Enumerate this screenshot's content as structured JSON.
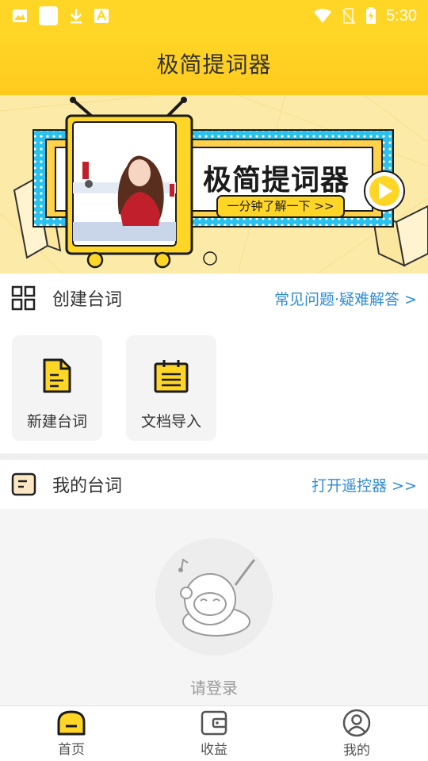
{
  "status_bar": {
    "time": "5:30",
    "left_icons": [
      "image-icon",
      "square-notification-icon",
      "download-icon",
      "app-a-icon"
    ],
    "right_icons": [
      "wifi-icon",
      "no-sim-icon",
      "battery-charging-icon"
    ]
  },
  "header": {
    "title": "极简提词器"
  },
  "banner": {
    "title": "极简提词器",
    "subtitle": "一分钟了解一下 >>"
  },
  "create_section": {
    "title": "创建台词",
    "link": "常见问题·疑难解答 >",
    "cards": [
      {
        "label": "新建台词",
        "icon": "new-document-icon"
      },
      {
        "label": "文档导入",
        "icon": "import-document-icon"
      }
    ]
  },
  "my_section": {
    "title": "我的台词",
    "link": "打开遥控器 >>",
    "empty_text": "请登录"
  },
  "tabbar": {
    "tabs": [
      {
        "label": "首页",
        "icon": "home-icon",
        "active": true
      },
      {
        "label": "收益",
        "icon": "wallet-icon",
        "active": false
      },
      {
        "label": "我的",
        "icon": "profile-icon",
        "active": false
      }
    ]
  },
  "colors": {
    "brand_yellow": "#FFD626",
    "link_blue": "#2F8BD8",
    "banner_blue": "#2BC1EE"
  }
}
